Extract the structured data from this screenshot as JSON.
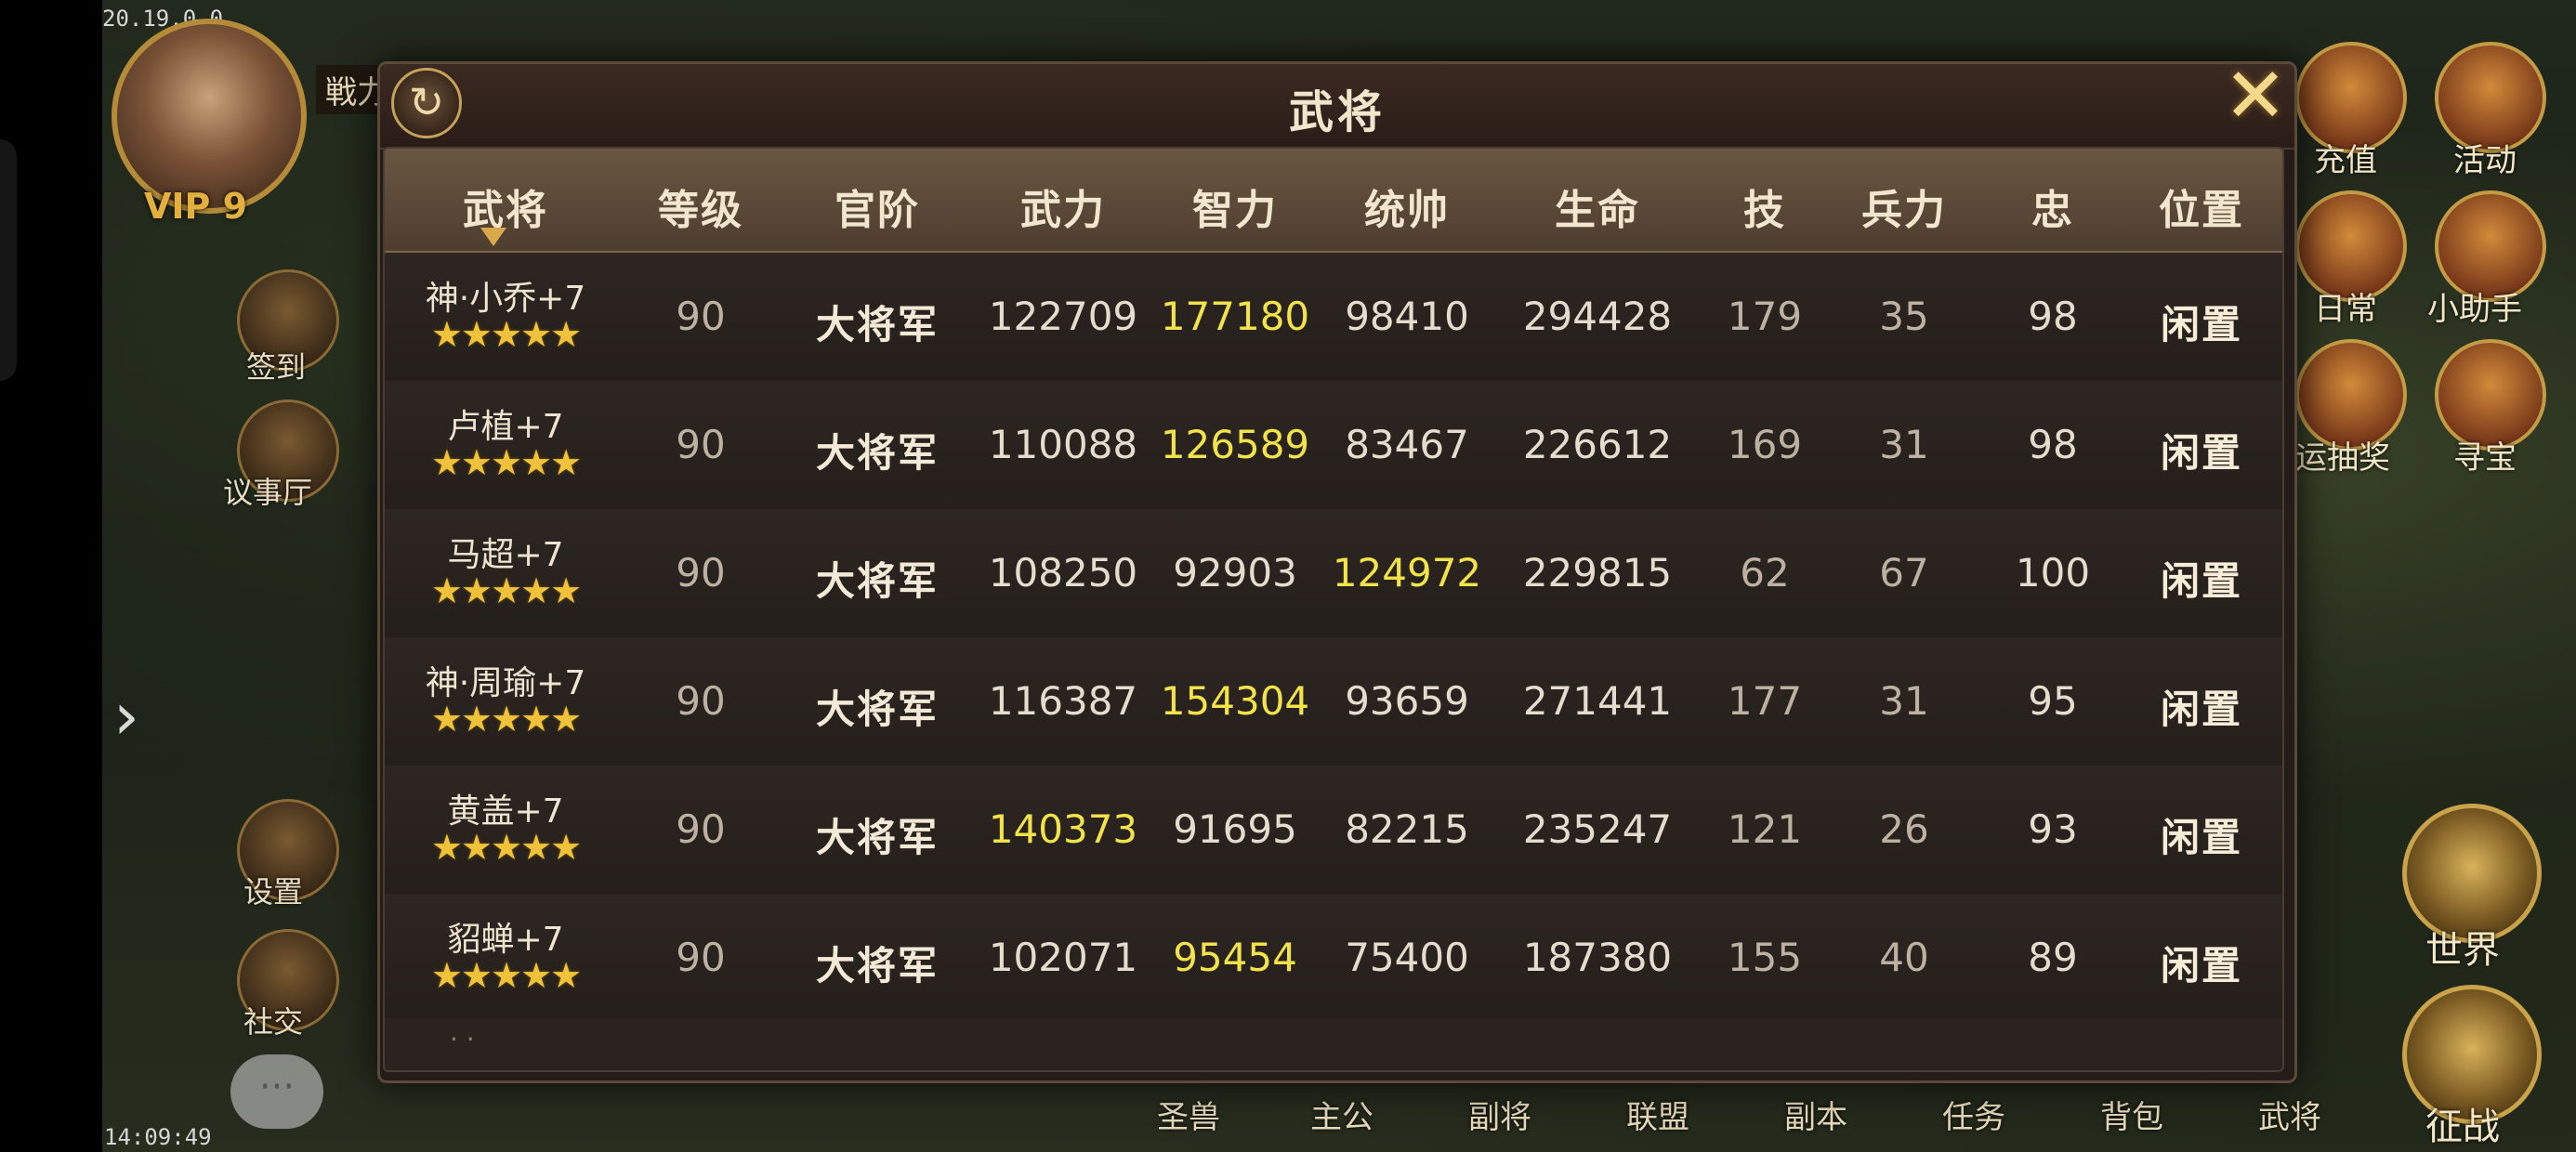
{
  "status": {
    "version": "20.19.0.0",
    "clock": "14:09:49"
  },
  "player": {
    "vip": "VIP 9",
    "battle_tag": "戦力"
  },
  "left_menu": [
    {
      "label": "签到"
    },
    {
      "label": "议事厅"
    },
    {
      "label": "设置"
    },
    {
      "label": "社交"
    }
  ],
  "right_menu": [
    {
      "label": "充值"
    },
    {
      "label": "活动"
    },
    {
      "label": "日常"
    },
    {
      "label": "小助手"
    },
    {
      "label": "运抽奖"
    },
    {
      "label": "寻宝"
    },
    {
      "label": "世界"
    },
    {
      "label": "征战"
    }
  ],
  "bottom_menu": [
    "圣兽",
    "主公",
    "副将",
    "联盟",
    "副本",
    "任务",
    "背包",
    "武将"
  ],
  "dialog": {
    "title": "武将",
    "columns": [
      "武将",
      "等级",
      "官阶",
      "武力",
      "智力",
      "统帅",
      "生命",
      "技",
      "兵力",
      "忠",
      "位置"
    ],
    "stars": "★★★★★",
    "rows": [
      {
        "name": "神·小乔+7",
        "level": "90",
        "rank": "大将军",
        "str": "122709",
        "int": "177180",
        "cmd": "98410",
        "hp": "294428",
        "skill": "179",
        "troops": "35",
        "loyalty": "98",
        "position": "闲置",
        "highlight": "int"
      },
      {
        "name": "卢植+7",
        "level": "90",
        "rank": "大将军",
        "str": "110088",
        "int": "126589",
        "cmd": "83467",
        "hp": "226612",
        "skill": "169",
        "troops": "31",
        "loyalty": "98",
        "position": "闲置",
        "highlight": "int"
      },
      {
        "name": "马超+7",
        "level": "90",
        "rank": "大将军",
        "str": "108250",
        "int": "92903",
        "cmd": "124972",
        "hp": "229815",
        "skill": "62",
        "troops": "67",
        "loyalty": "100",
        "position": "闲置",
        "highlight": "cmd"
      },
      {
        "name": "神·周瑜+7",
        "level": "90",
        "rank": "大将军",
        "str": "116387",
        "int": "154304",
        "cmd": "93659",
        "hp": "271441",
        "skill": "177",
        "troops": "31",
        "loyalty": "95",
        "position": "闲置",
        "highlight": "int"
      },
      {
        "name": "黄盖+7",
        "level": "90",
        "rank": "大将军",
        "str": "140373",
        "int": "91695",
        "cmd": "82215",
        "hp": "235247",
        "skill": "121",
        "troops": "26",
        "loyalty": "93",
        "position": "闲置",
        "highlight": "str"
      },
      {
        "name": "貂蝉+7",
        "level": "90",
        "rank": "大将军",
        "str": "102071",
        "int": "95454",
        "cmd": "75400",
        "hp": "187380",
        "skill": "155",
        "troops": "40",
        "loyalty": "89",
        "position": "闲置",
        "highlight": "int"
      }
    ]
  },
  "colors": {
    "highlight": "#f2e34a",
    "star": "#f0c23a",
    "header_bg": "#5a4838"
  }
}
